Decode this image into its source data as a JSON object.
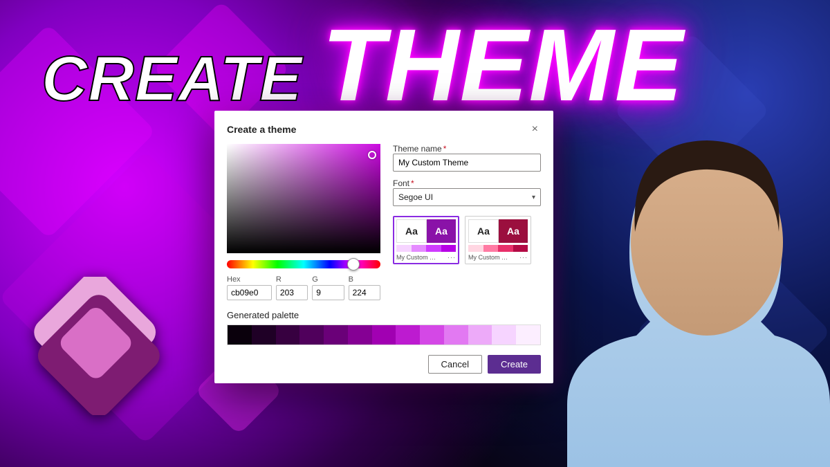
{
  "headline": {
    "word1": "Create",
    "word2": "Theme"
  },
  "dialog": {
    "title": "Create a theme",
    "close": "×",
    "hexLabel": "Hex",
    "rLabel": "R",
    "gLabel": "G",
    "bLabel": "B",
    "hex": "cb09e0",
    "r": "203",
    "g": "9",
    "b": "224",
    "themeNameLabel": "Theme name",
    "themeName": "My Custom Theme",
    "fontLabel": "Font",
    "font": "Segoe UI",
    "previewSample": "Aa",
    "previews": [
      {
        "name": "My Custom …",
        "accent": "#8a12a8",
        "palette": [
          "#f6d4ff",
          "#e58bff",
          "#cf3bff",
          "#b700e6"
        ]
      },
      {
        "name": "My Custom …",
        "accent": "#9b0f3e",
        "palette": [
          "#ffd6e2",
          "#ff7aa3",
          "#e8306a",
          "#b30b45"
        ]
      }
    ],
    "more": "···",
    "generatedLabel": "Generated palette",
    "generatedPalette": [
      "#0a000c",
      "#1f0026",
      "#370040",
      "#50005c",
      "#6a0078",
      "#850094",
      "#a100b2",
      "#bd1bd0",
      "#d448e6",
      "#e279f2",
      "#edaaf9",
      "#f6d4ff",
      "#fceeff"
    ],
    "cancel": "Cancel",
    "create": "Create"
  },
  "colors": {
    "accent": "#cb09e0",
    "brand": "#5c2d91"
  }
}
